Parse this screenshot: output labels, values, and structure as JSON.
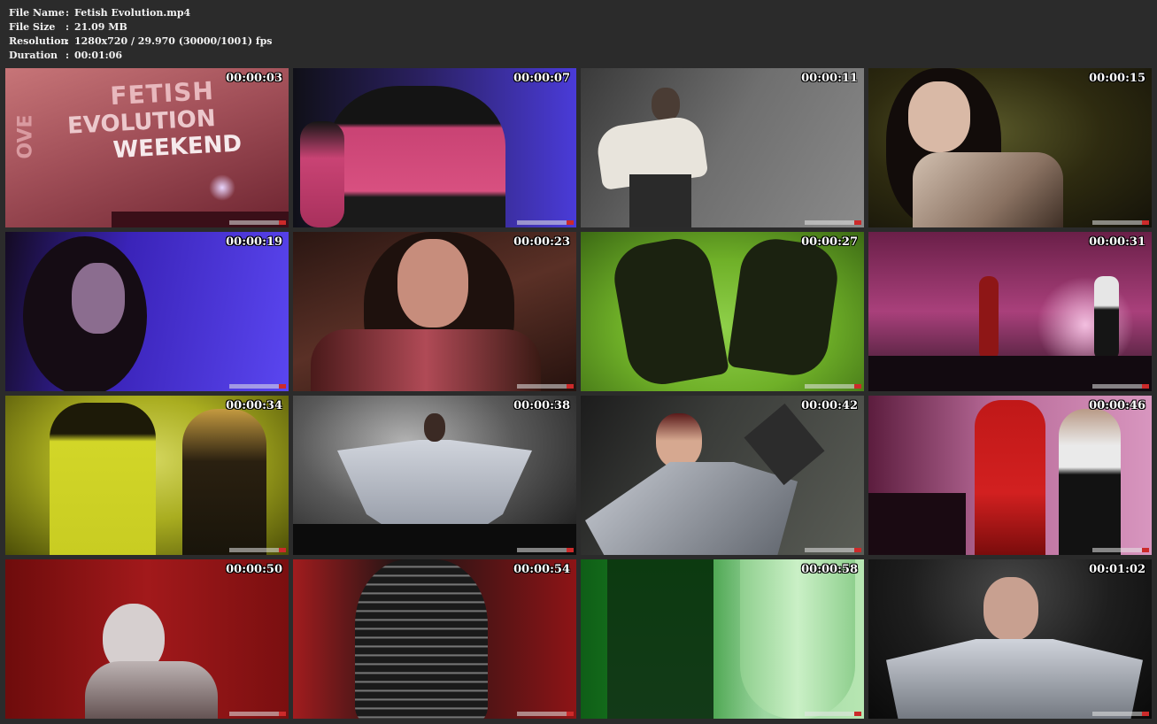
{
  "info": [
    {
      "key": "File Name",
      "sep": ":",
      "value": "Fetish Evolution.mp4"
    },
    {
      "key": "File Size",
      "sep": ":",
      "value": "21.09 MB"
    },
    {
      "key": "Resolution",
      "sep": ":",
      "value": "1280x720 / 29.970 (30000/1001) fps"
    },
    {
      "key": "Duration",
      "sep": ":",
      "value": "00:01:06"
    }
  ],
  "thumbs": [
    {
      "time": "00:00:03",
      "scene": "stage-sign",
      "sign_lines": [
        "FETISH",
        "EVOLUTION",
        "WEEKEND"
      ],
      "sign_side": "OVE"
    },
    {
      "time": "00:00:07",
      "scene": "pink-latex-dress"
    },
    {
      "time": "00:00:11",
      "scene": "dancing-man-grey"
    },
    {
      "time": "00:00:15",
      "scene": "woman-dark-hair"
    },
    {
      "time": "00:00:19",
      "scene": "woman-blue-light"
    },
    {
      "time": "00:00:23",
      "scene": "woman-closeup"
    },
    {
      "time": "00:00:27",
      "scene": "heels-green-floor"
    },
    {
      "time": "00:00:31",
      "scene": "stage-pink-curtain"
    },
    {
      "time": "00:00:34",
      "scene": "yellow-latex"
    },
    {
      "time": "00:00:38",
      "scene": "silver-kimono-stage"
    },
    {
      "time": "00:00:42",
      "scene": "silver-kimono-side"
    },
    {
      "time": "00:00:46",
      "scene": "red-latex-catsuit"
    },
    {
      "time": "00:00:50",
      "scene": "bald-woman-red"
    },
    {
      "time": "00:00:54",
      "scene": "black-latex-boots"
    },
    {
      "time": "00:00:58",
      "scene": "green-latex-dress"
    },
    {
      "time": "00:01:02",
      "scene": "silver-kimono-front"
    }
  ],
  "colors": {
    "background": "#2b2b2b",
    "text": "#f2f2f2",
    "timestamp": "#ffffff"
  }
}
